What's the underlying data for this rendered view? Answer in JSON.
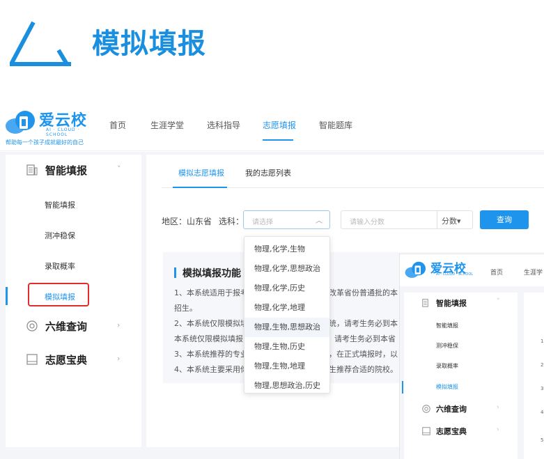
{
  "heading": {
    "title": "模拟填报"
  },
  "brand": {
    "name": "爱云校",
    "en": "AI · CLOUD · SCHOOL",
    "slogan": "帮助每一个孩子成就最好的自己"
  },
  "nav": {
    "items": [
      "首页",
      "生涯学堂",
      "选科指导",
      "志愿填报",
      "智能题库"
    ],
    "active_index": 3
  },
  "sidebar": {
    "groups": [
      {
        "label": "智能填报",
        "icon": "list-icon",
        "arrow": "˅",
        "items": [
          "智能填报",
          "冲稳保",
          "录取概率",
          "模拟填报"
        ]
      },
      {
        "label": "六维查询",
        "icon": "radar-icon",
        "arrow": "›"
      },
      {
        "label": "志愿宝典",
        "icon": "book-icon",
        "arrow": "›"
      }
    ],
    "items_display": [
      "智能填报",
      "测冲稳保",
      "录取概率",
      "模拟填报"
    ],
    "active_item": "模拟填报"
  },
  "tabs": [
    "模拟志愿填报",
    "我的志愿列表"
  ],
  "filter": {
    "region_label": "地区：山东省",
    "subject_label": "选科：",
    "subject_placeholder": "请选择",
    "score_placeholder": "请输入分数",
    "score_unit": "分数▾",
    "query_label": "查询"
  },
  "info": {
    "title": "模拟填报功能",
    "lines": [
      "1、本系统适用于报考",
      "招生。",
      "2、本系统仅限模拟填",
      "本系统仅限模拟填报",
      "3、本系统推荐的专业",
      "4、本系统主要采用你"
    ],
    "lines_right": [
      "改革省份普通批的本",
      "",
      "统，请考生务必到本",
      "请考生务必到本省",
      "，在正式填报时，以",
      "生推荐合适的院校。"
    ]
  },
  "dropdown": {
    "options": [
      "物理,化学,生物",
      "物理,化学,思想政治",
      "物理,化学,历史",
      "物理,化学,地理",
      "物理,生物,思想政治",
      "物理,生物,历史",
      "物理,生物,地理",
      "物理,思想政治,历史"
    ],
    "hover_index": 4
  },
  "mini": {
    "brand": "爱云校",
    "en": "AI · CLOUD · SCHOOL",
    "nav_items": [
      "首页",
      "生涯学"
    ],
    "groups": [
      "智能填报",
      "六维查询",
      "志愿宝典"
    ],
    "items": [
      "智能填报",
      "测冲稳保",
      "录取概率",
      "模拟填报"
    ],
    "digits": [
      "1",
      "2",
      "3",
      "4",
      "5"
    ]
  },
  "colors": {
    "accent": "#1e94ec",
    "highlight": "#e22b2b"
  }
}
